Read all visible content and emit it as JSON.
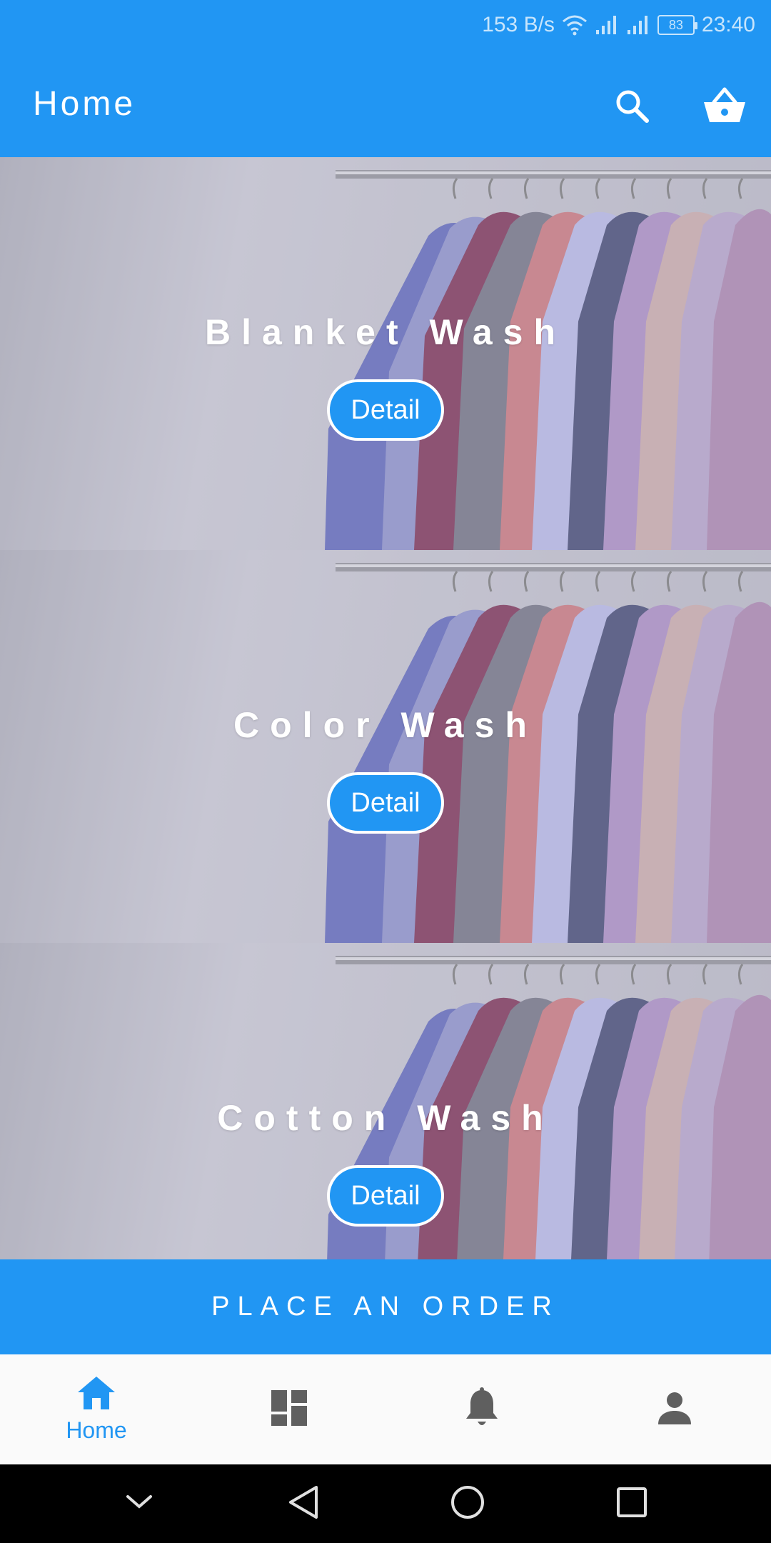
{
  "status_bar": {
    "speed": "153 B/s",
    "battery": "83",
    "time": "23:40",
    "icons": [
      "wifi-icon",
      "signal-icon",
      "signal-icon",
      "battery-icon"
    ]
  },
  "app_bar": {
    "title": "Home",
    "actions": [
      "search-icon",
      "basket-icon"
    ]
  },
  "services": [
    {
      "title": "Blanket Wash",
      "button": "Detail"
    },
    {
      "title": "Color Wash",
      "button": "Detail"
    },
    {
      "title": "Cotton Wash",
      "button": "Detail"
    }
  ],
  "order": {
    "label": "PLACE AN ORDER"
  },
  "bottom_nav": {
    "items": [
      {
        "icon": "home-icon",
        "label": "Home",
        "active": true
      },
      {
        "icon": "dashboard-icon",
        "label": "",
        "active": false
      },
      {
        "icon": "bell-icon",
        "label": "",
        "active": false
      },
      {
        "icon": "person-icon",
        "label": "",
        "active": false
      }
    ]
  },
  "system_nav": [
    "chevron-down-icon",
    "back-icon",
    "home-circle-icon",
    "recents-icon"
  ],
  "colors": {
    "primary": "#2196F3",
    "nav_inactive": "#5f5f5f",
    "system_bar": "#000000"
  }
}
